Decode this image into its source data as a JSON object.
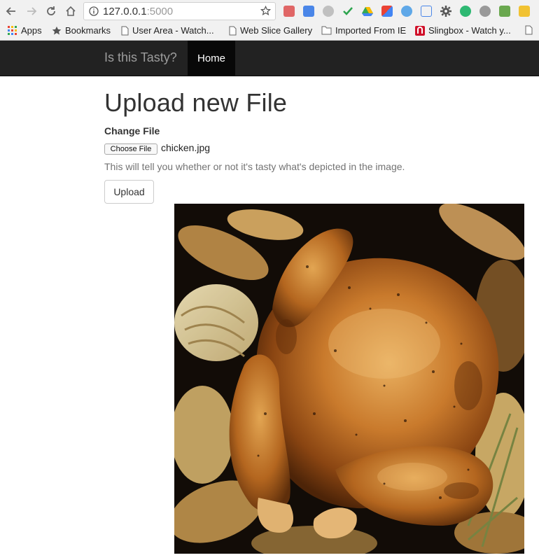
{
  "browser": {
    "url_host": "127.0.0.1",
    "url_port": ":5000",
    "icons": [
      "back-icon",
      "forward-icon",
      "reload-icon",
      "home-icon",
      "info-icon",
      "bookmark-star-icon",
      "settings-icon"
    ]
  },
  "bookmarks": {
    "items": [
      {
        "label": "Apps",
        "icon": "apps-grid-icon"
      },
      {
        "label": "Bookmarks",
        "icon": "star-icon"
      },
      {
        "label": "User Area - Watch...",
        "icon": "page-icon"
      },
      {
        "label": "Web Slice Gallery",
        "icon": "page-icon"
      },
      {
        "label": "Imported From IE",
        "icon": "folder-icon"
      },
      {
        "label": "Slingbox - Watch y...",
        "icon": "slingbox-icon"
      }
    ]
  },
  "navbar": {
    "brand": "Is this Tasty?",
    "home_label": "Home"
  },
  "main": {
    "title": "Upload new File",
    "field_label": "Change File",
    "choose_file_label": "Choose File",
    "file_name": "chicken.jpg",
    "help_text": "This will tell you whether or not it's tasty what's depicted in the image.",
    "upload_label": "Upload"
  },
  "colors": {
    "navbar_bg": "#222222",
    "navbar_active_bg": "#080808",
    "brand_color": "#9d9d9d"
  }
}
